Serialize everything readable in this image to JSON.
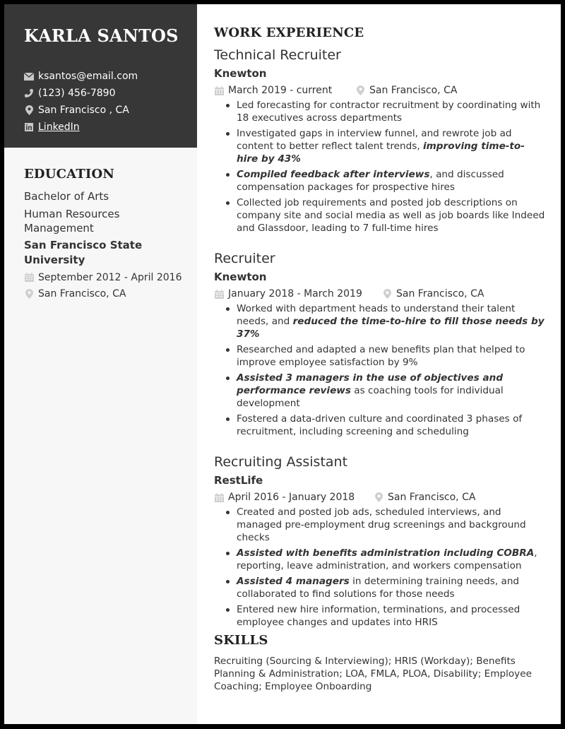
{
  "header": {
    "name": "KARLA SANTOS",
    "contact": {
      "email": {
        "icon": "envelope-icon",
        "text": "ksantos@email.com"
      },
      "phone": {
        "icon": "phone-icon",
        "text": "(123) 456-7890"
      },
      "location": {
        "icon": "map-pin-icon",
        "text": "San Francisco , CA"
      },
      "linkedin": {
        "icon": "linkedin-icon",
        "text": "LinkedIn"
      }
    }
  },
  "education": {
    "title": "EDUCATION",
    "degree": "Bachelor of Arts",
    "field": "Human Resources Management",
    "school": "San Francisco State University",
    "dates": "September 2012 - April 2016",
    "location": "San Francisco, CA"
  },
  "work": {
    "title": "WORK EXPERIENCE",
    "jobs": [
      {
        "title": "Technical Recruiter",
        "company": "Knewton",
        "dates": "March 2019 - current",
        "location": "San Francisco, CA",
        "bullets": [
          {
            "pre": "Led forecasting for contractor recruitment by coordinating with 18 executives across departments",
            "em": "",
            "post": ""
          },
          {
            "pre": "Investigated gaps in interview funnel, and rewrote job ad content to better reflect talent trends, ",
            "em": "improving time-to-hire by 43%",
            "post": ""
          },
          {
            "pre": "",
            "em": "Compiled feedback after interviews",
            "post": ", and discussed compensation packages for prospective hires"
          },
          {
            "pre": "Collected job requirements and posted job descriptions on company site and social media as well as job boards like Indeed and Glassdoor, leading to 7 full-time hires",
            "em": "",
            "post": ""
          }
        ]
      },
      {
        "title": "Recruiter",
        "company": "Knewton",
        "dates": "January 2018 - March 2019",
        "location": "San Francisco, CA",
        "bullets": [
          {
            "pre": "Worked with department heads to understand their talent needs, and ",
            "em": "reduced the time-to-hire to fill those needs by 37%",
            "post": ""
          },
          {
            "pre": "Researched and adapted a new benefits plan that helped to improve employee satisfaction by 9%",
            "em": "",
            "post": ""
          },
          {
            "pre": "",
            "em": "Assisted 3 managers in the use of objectives and performance reviews",
            "post": " as coaching tools for individual development"
          },
          {
            "pre": "Fostered a data-driven culture and coordinated 3 phases of recruitment, including screening and scheduling",
            "em": "",
            "post": ""
          }
        ]
      },
      {
        "title": "Recruiting Assistant",
        "company": "RestLife",
        "dates": "April 2016 - January 2018",
        "location": "San Francisco, CA",
        "bullets": [
          {
            "pre": "Created and posted job ads, scheduled interviews, and managed pre-employment drug screenings and background checks",
            "em": "",
            "post": ""
          },
          {
            "pre": "",
            "em": "Assisted with benefits administration including COBRA",
            "post": ", reporting, leave administration, and workers compensation"
          },
          {
            "pre": "",
            "em": "Assisted 4 managers",
            "post": " in determining training needs, and collaborated to find solutions for those needs"
          },
          {
            "pre": "Entered new hire information, terminations, and processed employee changes and updates into HRIS",
            "em": "",
            "post": ""
          }
        ]
      }
    ]
  },
  "skills": {
    "title": "SKILLS",
    "text": "Recruiting (Sourcing & Interviewing); HRIS (Workday); Benefits Planning & Administration; LOA, FMLA, PLOA, Disability; Employee Coaching; Employee Onboarding"
  },
  "colors": {
    "header_bg": "#373737",
    "sidebar_bg": "#f7f7f7",
    "text": "#333333",
    "icon_gray": "#c8c8c8",
    "frame": "#000000"
  }
}
